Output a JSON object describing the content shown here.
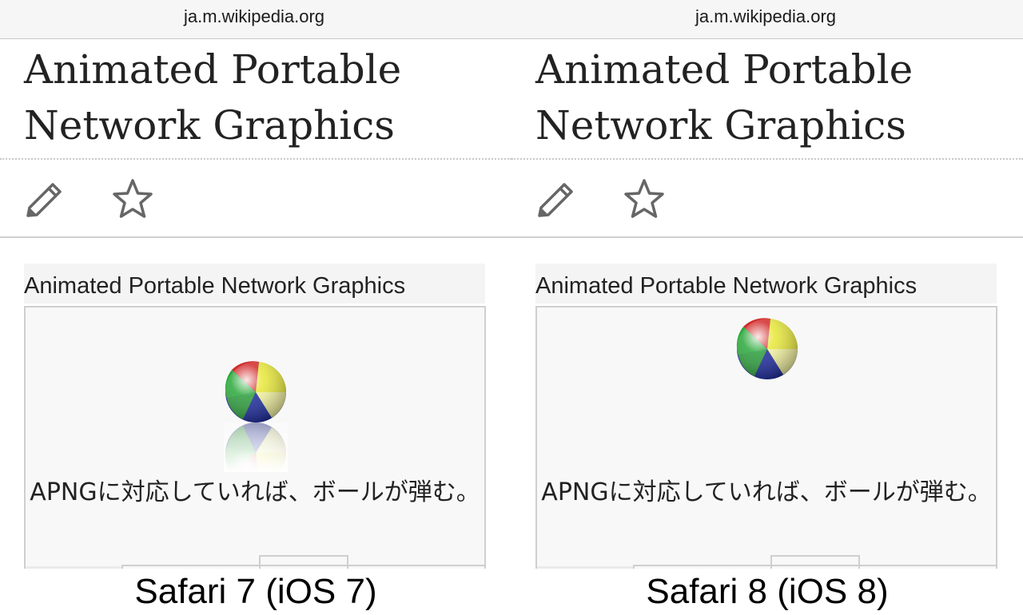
{
  "panels": [
    {
      "browser": {
        "url": "ja.m.wikipedia.org"
      },
      "article": {
        "title": "Animated Portable Network Graphics",
        "actions": {
          "edit_icon": "pencil-icon",
          "watch_icon": "star-icon"
        }
      },
      "infobox": {
        "heading": "Animated Portable Network Graphics",
        "image_icon": "beach-ball-icon",
        "caption": "APNGに対応していれば、ボールが弾む。"
      },
      "label": "Safari 7 (iOS 7)"
    },
    {
      "browser": {
        "url": "ja.m.wikipedia.org"
      },
      "article": {
        "title": "Animated Portable Network Graphics",
        "actions": {
          "edit_icon": "pencil-icon",
          "watch_icon": "star-icon"
        }
      },
      "infobox": {
        "heading": "Animated Portable Network Graphics",
        "image_icon": "beach-ball-icon",
        "caption": "APNGに対応していれば、ボールが弾む。"
      },
      "label": "Safari 8 (iOS 8)"
    }
  ],
  "colors": {
    "text": "#222222",
    "url_bar": "#f6f6f6",
    "infobox_bg": "#f8f8f8",
    "border": "#cfcfcf",
    "icon": "#666666"
  }
}
